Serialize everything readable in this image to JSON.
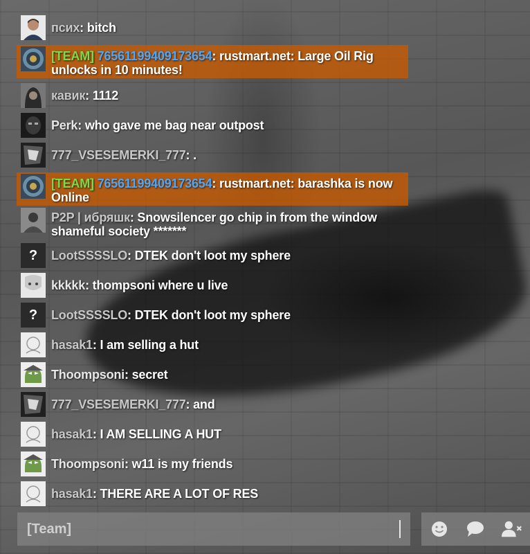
{
  "chat": {
    "messages": [
      {
        "avatar": "person-photo-avatar",
        "name": "псих",
        "sep": ": ",
        "body": "bitch"
      },
      {
        "avatar": "rust-team-logo-avatar",
        "tag": "[TEAM]",
        "name": "76561199409173654",
        "sep": ": ",
        "body": "rustmart.net: Large Oil Rig unlocks in 10 minutes!"
      },
      {
        "avatar": "hooded-figure-avatar",
        "name": "кавик",
        "sep": ": ",
        "body": "1112"
      },
      {
        "avatar": "mask-avatar",
        "name": "Perk",
        "sep": ": ",
        "body": "who gave me bag near outpost"
      },
      {
        "avatar": "anime-avatar",
        "name": "777_VSESEMERKI_777",
        "sep": ": ",
        "body": "."
      },
      {
        "avatar": "rust-team-logo-avatar",
        "tag": "[TEAM]",
        "name": "76561199409173654",
        "sep": ": ",
        "body": "rustmart.net: barashka is now Online"
      },
      {
        "avatar": "soldier-avatar",
        "clan": "P2P | ",
        "name": "ибряшк",
        "sep": ": ",
        "body": "Snowsilencer go chip in from the window shameful society *******"
      },
      {
        "avatar": "question-mark-avatar",
        "avatar_text": "?",
        "name": "LootSSSSLO",
        "sep": ": ",
        "body": "DTEK don't loot my sphere"
      },
      {
        "avatar": "anime-girl-avatar",
        "name": "kkkkk",
        "sep": ": ",
        "body": "thompsoni where u live"
      },
      {
        "avatar": "question-mark-avatar",
        "avatar_text": "?",
        "name": "LootSSSSLO",
        "sep": ": ",
        "body": "DTEK don't loot my sphere"
      },
      {
        "avatar": "sketch-avatar",
        "name": "hasak1",
        "sep": ": ",
        "body": "I am selling a hut"
      },
      {
        "avatar": "pepe-frog-avatar",
        "name": "Thoompsoni",
        "sep": ": ",
        "body": "secret"
      },
      {
        "avatar": "anime-avatar",
        "name": "777_VSESEMERKI_777",
        "sep": ": ",
        "body": "and"
      },
      {
        "avatar": "sketch-avatar",
        "name": "hasak1",
        "sep": ": ",
        "body": "I AM SELLING A HUT"
      },
      {
        "avatar": "pepe-frog-avatar",
        "name": "Thoompsoni",
        "sep": ": ",
        "body": "w11 is my friends"
      },
      {
        "avatar": "sketch-avatar",
        "name": "hasak1",
        "sep": ": ",
        "body": "THERE ARE A LOT OF RES"
      }
    ]
  },
  "input": {
    "placeholder": "[Team]"
  },
  "buttons": [
    {
      "name": "emoji-button",
      "icon": "smiley-icon"
    },
    {
      "name": "chat-channel-button",
      "icon": "speech-bubble-icon"
    },
    {
      "name": "mute-user-button",
      "icon": "user-remove-icon"
    }
  ]
}
